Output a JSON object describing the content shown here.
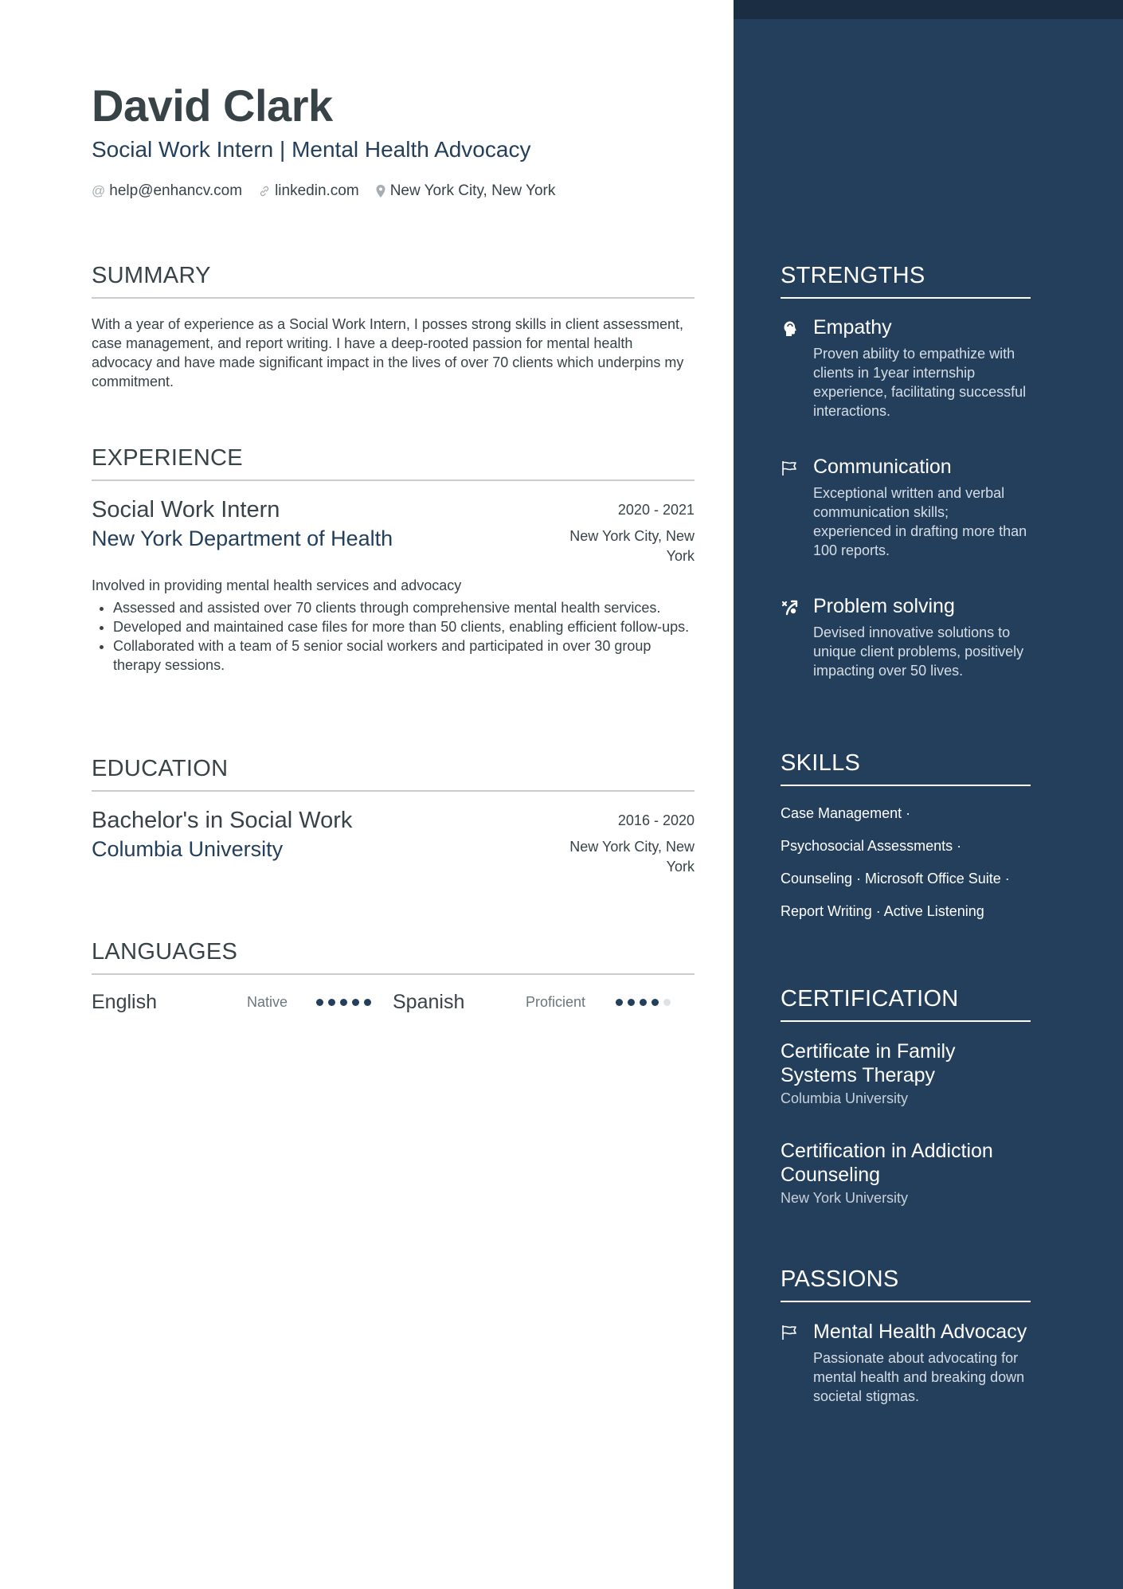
{
  "header": {
    "name": "David Clark",
    "title": "Social Work Intern | Mental Health Advocacy",
    "contacts": [
      {
        "icon": "at-icon",
        "text": "help@enhancv.com"
      },
      {
        "icon": "link-icon",
        "text": "linkedin.com"
      },
      {
        "icon": "location-pin-icon",
        "text": "New York City, New York"
      }
    ]
  },
  "summary": {
    "heading": "SUMMARY",
    "text": "With a year of experience as a Social Work Intern, I posses strong skills in client assessment, case management, and report writing. I have a deep-rooted passion for mental health advocacy and have made significant impact in the lives of over 70 clients which underpins my commitment."
  },
  "experience": {
    "heading": "EXPERIENCE",
    "items": [
      {
        "role": "Social Work Intern",
        "dates": "2020 - 2021",
        "organization": "New York Department of Health",
        "location": "New York City, New York",
        "description": "Involved in providing mental health services and advocacy",
        "bullets": [
          "Assessed and assisted over 70 clients through comprehensive mental health services.",
          "Developed and maintained case files for more than 50 clients, enabling efficient follow-ups.",
          "Collaborated with a team of 5 senior social workers and participated in over 30 group therapy sessions."
        ]
      }
    ]
  },
  "education": {
    "heading": "EDUCATION",
    "items": [
      {
        "degree": "Bachelor's in Social Work",
        "dates": "2016 - 2020",
        "school": "Columbia University",
        "location": "New York City, New York"
      }
    ]
  },
  "languages": {
    "heading": "LANGUAGES",
    "items": [
      {
        "name": "English",
        "level": "Native",
        "rating": 5,
        "max": 5
      },
      {
        "name": "Spanish",
        "level": "Proficient",
        "rating": 4,
        "max": 5
      }
    ]
  },
  "strengths": {
    "heading": "STRENGTHS",
    "items": [
      {
        "icon": "head-icon",
        "title": "Empathy",
        "description": "Proven ability to empathize with clients in 1year internship experience, facilitating successful interactions."
      },
      {
        "icon": "flag-icon",
        "title": "Communication",
        "description": "Exceptional written and verbal communication skills; experienced in drafting more than 100 reports."
      },
      {
        "icon": "strategy-icon",
        "title": "Problem solving",
        "description": "Devised innovative solutions to unique client problems, positively impacting over 50 lives."
      }
    ]
  },
  "skills": {
    "heading": "SKILLS",
    "lines": [
      "Case Management ·",
      "Psychosocial Assessments ·",
      "Counseling · Microsoft Office Suite ·",
      "Report Writing · Active Listening"
    ]
  },
  "certification": {
    "heading": "CERTIFICATION",
    "items": [
      {
        "title": "Certificate in Family Systems Therapy",
        "issuer": "Columbia University"
      },
      {
        "title": "Certification in Addiction Counseling",
        "issuer": "New York University"
      }
    ]
  },
  "passions": {
    "heading": "PASSIONS",
    "items": [
      {
        "icon": "flag-icon",
        "title": "Mental Health Advocacy",
        "description": "Passionate about advocating for mental health and breaking down societal stigmas."
      }
    ]
  },
  "colors": {
    "sidebar": "#233f5c",
    "sidebar_top": "#1b2d42",
    "accent": "#233f5c",
    "text": "#384347"
  }
}
